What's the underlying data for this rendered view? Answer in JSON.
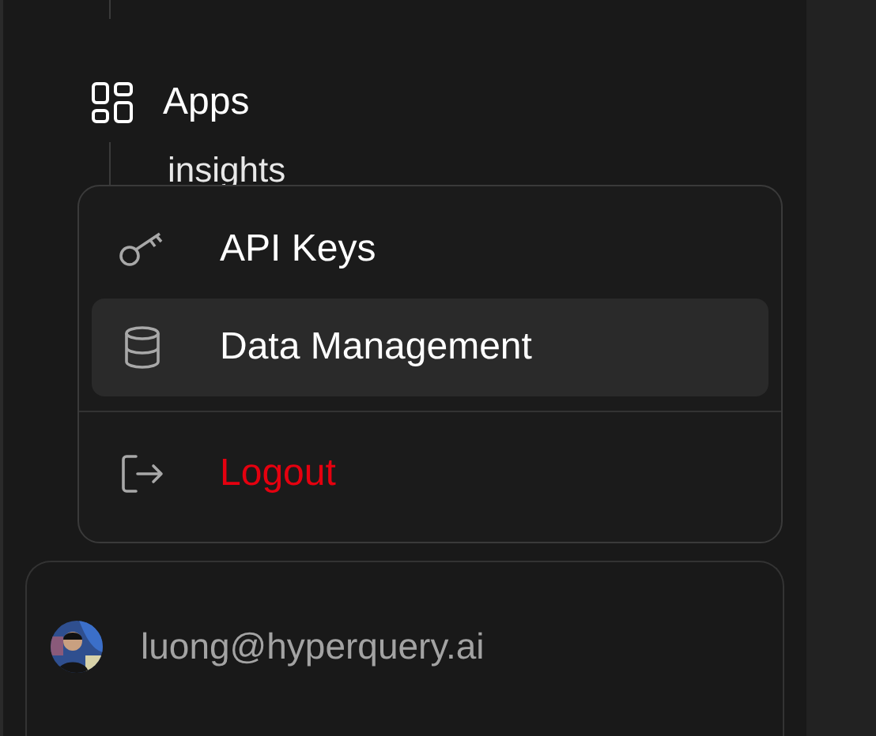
{
  "nav": {
    "items": [
      {
        "label": "Apps",
        "kind": "section"
      },
      {
        "label": "insights",
        "kind": "child"
      }
    ]
  },
  "menu": {
    "items": [
      {
        "label": "API Keys",
        "kind": "normal",
        "selected": false
      },
      {
        "label": "Data Management",
        "kind": "normal",
        "selected": true
      },
      {
        "label": "Logout",
        "kind": "danger",
        "selected": false
      }
    ]
  },
  "user": {
    "email": "luong@hyperquery.ai"
  }
}
